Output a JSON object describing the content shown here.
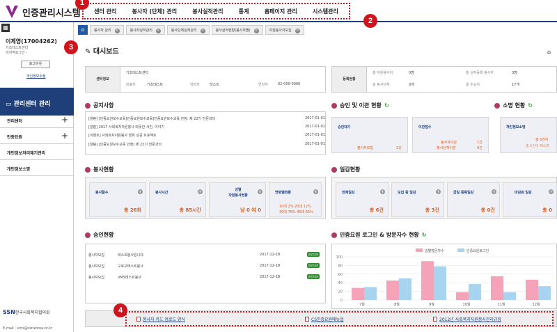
{
  "app": {
    "title": "인증관리시스템",
    "logo": "V"
  },
  "menu": [
    "센터 관리",
    "봉사자 (단체) 관리",
    "봉사실적관리",
    "통계",
    "홈페이지 관리",
    "시스템관리"
  ],
  "badges": [
    "1",
    "2",
    "3",
    "4"
  ],
  "sidebar": {
    "grid": "grid-icon",
    "user_name": "이제영(17004262)",
    "center": "기초테스트센터",
    "role": "마지막로그인 -",
    "logout": "로그아웃",
    "profile_link": "개인정보수정",
    "heading": "관리센터 관리",
    "items": [
      {
        "label": "관리센터",
        "expand": "+"
      },
      {
        "label": "인증요원",
        "expand": "+"
      },
      {
        "label": "개인정보처리제기관리"
      },
      {
        "label": "개인정보소명"
      }
    ],
    "org": "SSN",
    "org_name": "한국사회복지협의회",
    "email": "E-mail : vms@ssnkorea.or.kr"
  },
  "tabs": [
    "봉사자 관리",
    "봉사자실적관리",
    "봉사단체실적관리",
    "봉사실적현황(봉사자별)",
    "자원봉사자모집"
  ],
  "page_title": "대시보드",
  "center_info": {
    "label": "센터정보",
    "name": "기초테스트센터",
    "rep_label": "대표자",
    "rep": "기초테스트",
    "manager_label": "담당자",
    "manager": "테스트",
    "phone_label": "연락처",
    "phone": "02-000-0000"
  },
  "reg_status": {
    "label": "등록현황",
    "a_label": "총 자원봉사자",
    "a": "0명",
    "b_label": "총 실적등록 봉사자",
    "b": "3명",
    "c_label": "총 봉사단체",
    "c": "0개",
    "d_label": "총 수요처",
    "d": "17개"
  },
  "sections": {
    "notice": "공지사항",
    "approval": "승인 및 이관 현황",
    "explain": "소명 현황",
    "service": "봉사현황",
    "jobs": "일감현황",
    "approve_status": "승인현황",
    "login": "인증요원 로그인 & 방문자수 현황"
  },
  "notices": [
    {
      "text": "[알림] [인증요원보수교육]인증요원보수교육]인증요원보수교육 안정: 제 22기 전문과의",
      "date": "2017-01-01"
    },
    {
      "text": "[알림] 2017 사회복지자원봉사 따뜻한 사진, 이야기",
      "date": "2017-01-01"
    },
    {
      "text": "[이벤트] 사회복지자원봉사 명위 성공 프로젝트",
      "date": "2017-01-01"
    },
    {
      "text": "[알림] [인증요원보수교육 안정] 제 22기 전문과의",
      "date": "2017-01-01"
    }
  ],
  "approval_cards": [
    {
      "title": "승인대기",
      "rows": [
        {
          "label": "봉사자모집",
          "value": "2건"
        }
      ]
    },
    {
      "title": "이관접수",
      "rows": [
        {
          "label": "봉사자이관",
          "value": "1건"
        },
        {
          "label": "봉사단체이관",
          "value": "0건"
        }
      ]
    }
  ],
  "explain_card": {
    "title": "개인정보소명",
    "l1": "총 0건이",
    "l2": "총 1건이 제소명"
  },
  "service_cards": [
    {
      "title": "봉사활수",
      "value": "총 26회"
    },
    {
      "title": "봉사시간",
      "value": "총 85시간"
    },
    {
      "title": "성별\n자원봉사현황",
      "value": "남 0 여 0"
    },
    {
      "title": "연령별현황",
      "l1": "10대  2%  20대 12%",
      "l2": "30대 76%  40대 65%"
    }
  ],
  "job_cards": [
    {
      "title": "전체일감",
      "value": "총 6건"
    },
    {
      "title": "모집 중 일감",
      "value": "총 3건"
    },
    {
      "title": "금일 등록일감",
      "value": "총 0건"
    },
    {
      "title": "마감된 일감",
      "value": "총 0"
    }
  ],
  "approvals": [
    {
      "type": "봉사자모집",
      "title": "테스트봉사입니다.",
      "date": "2017-12-18",
      "status": "승인대기"
    },
    {
      "type": "봉사자모집",
      "title": "구로구테스트봉사",
      "date": "2017-12-18",
      "status": "승인대기"
    },
    {
      "type": "봉사자모집",
      "title": "VMS테스트봉사",
      "date": "2017-12-18",
      "status": "승인대기"
    }
  ],
  "downloads": [
    "봉사자 카드 업로드 양식",
    "CS인증요원매뉴얼",
    "2012년 사회복지자원봉사관리규정"
  ],
  "chart_data": {
    "type": "bar",
    "categories": [
      "7월",
      "8월",
      "9월",
      "10월",
      "11월",
      "12월"
    ],
    "ylim": [
      0,
      100
    ],
    "yticks": [
      "0",
      "20",
      "40",
      "60",
      "80",
      "100"
    ],
    "series": [
      {
        "name": "일별방문자수",
        "color": "#f5a3b8",
        "values": [
          28,
          45,
          90,
          18,
          55,
          47
        ]
      },
      {
        "name": "인증요원로그인",
        "color": "#a8d4f0",
        "values": [
          30,
          50,
          78,
          37,
          18,
          32
        ]
      }
    ]
  }
}
